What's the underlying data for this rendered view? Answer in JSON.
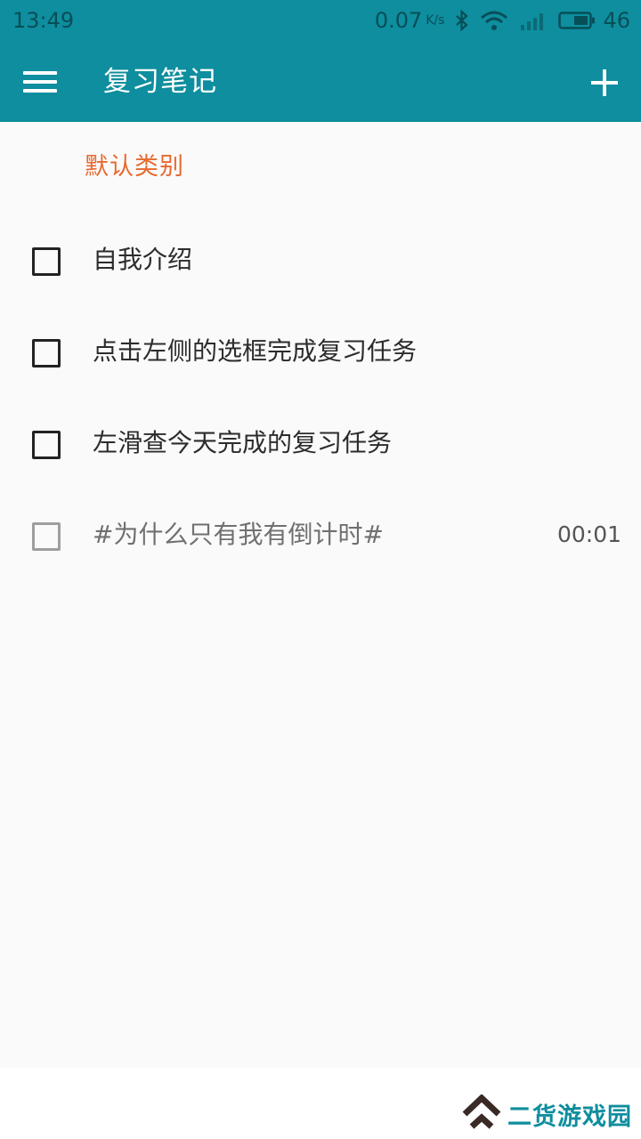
{
  "status_bar": {
    "time": "13:49",
    "net_speed": "0.07",
    "net_unit": "K/s",
    "battery": "46",
    "icons": [
      "bluetooth-icon",
      "wifi-icon",
      "signal-icon",
      "battery-icon"
    ]
  },
  "app_bar": {
    "title": "复习笔记",
    "menu_icon": "hamburger-menu-icon",
    "add_icon": "plus-icon"
  },
  "category": "默认类别",
  "tasks": [
    {
      "label": "自我介绍",
      "time": ""
    },
    {
      "label": "点击左侧的选框完成复习任务",
      "time": ""
    },
    {
      "label": "左滑查今天完成的复习任务",
      "time": ""
    },
    {
      "label": "#为什么只有我有倒计时#",
      "time": "00:01"
    }
  ],
  "watermark": {
    "text": "二货游戏园"
  },
  "colors": {
    "primary": "#0e8e9e",
    "category": "#e8692f",
    "background": "#fafafa"
  }
}
